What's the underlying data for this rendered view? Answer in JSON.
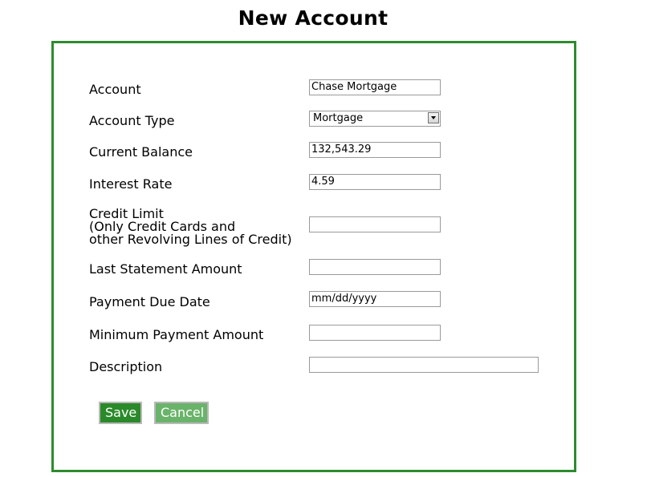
{
  "page": {
    "title": "New Account"
  },
  "form": {
    "account": {
      "label": "Account",
      "value": "Chase Mortgage"
    },
    "account_type": {
      "label": "Account Type",
      "selected": "Mortgage"
    },
    "current_balance": {
      "label": "Current Balance",
      "value": "132,543.29"
    },
    "interest_rate": {
      "label": "Interest Rate",
      "value": "4.59"
    },
    "credit_limit": {
      "label_line1": "Credit Limit",
      "label_line2": "(Only Credit Cards and",
      "label_line3": "other Revolving Lines of Credit)",
      "value": ""
    },
    "last_statement_amount": {
      "label": "Last Statement Amount",
      "value": ""
    },
    "payment_due_date": {
      "label": "Payment Due Date",
      "placeholder": "mm/dd/yyyy"
    },
    "minimum_payment_amount": {
      "label": "Minimum Payment Amount",
      "value": ""
    },
    "description": {
      "label": "Description",
      "value": ""
    }
  },
  "buttons": {
    "save_label": "Save",
    "cancel_label": "Cancel"
  },
  "colors": {
    "panel_border": "#2e8b2e",
    "save_button": "#2a8a2a",
    "cancel_button": "#6ab36a"
  }
}
